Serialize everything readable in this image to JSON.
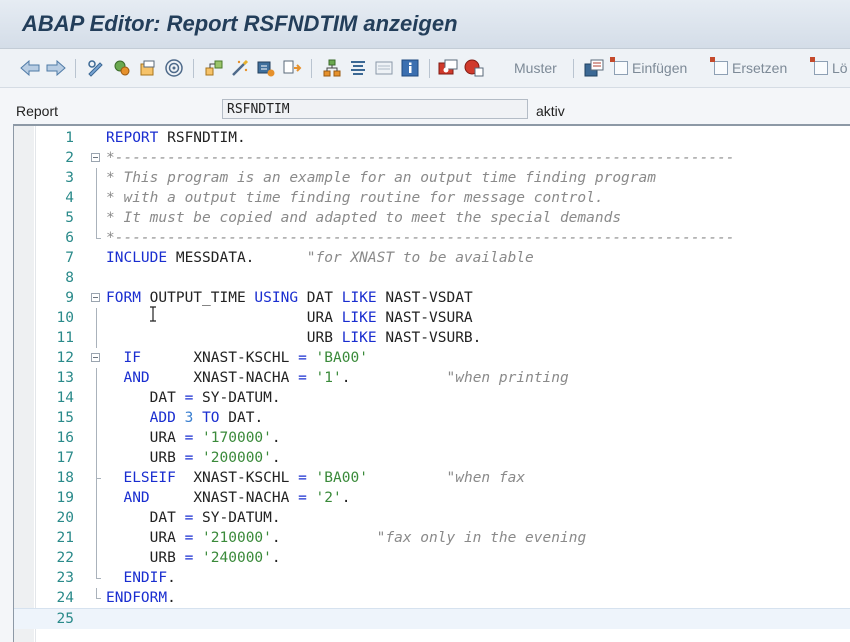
{
  "window": {
    "title": "ABAP Editor: Report RSFNDTIM anzeigen"
  },
  "toolbar": {
    "icons": [
      "back-arrow",
      "forward-arrow",
      "toggle-edit",
      "activate",
      "object-list",
      "where-used",
      "navigation",
      "pretty-printer",
      "enhancement",
      "check",
      "display-object",
      "info",
      "breakpoint-session",
      "breakpoint-external"
    ],
    "muster_label": "Muster",
    "einfuegen_label": "Einfügen",
    "ersetzen_label": "Ersetzen",
    "loeschen_label": "Lö"
  },
  "report": {
    "label": "Report",
    "name": "RSFNDTIM",
    "status": "aktiv"
  },
  "colors": {
    "keyword": "#1a2ed0",
    "comment": "#8a8a8a",
    "string": "#3a8a3a",
    "number": "#3a7fd0",
    "line_number": "#2a8a8a"
  },
  "code": [
    {
      "n": "1",
      "fold": "none",
      "tokens": [
        [
          "kw",
          "REPORT"
        ],
        [
          "id",
          " RSFNDTIM."
        ]
      ]
    },
    {
      "n": "2",
      "fold": "box",
      "tokens": [
        [
          "cm",
          "*-----------------------------------------------------------------------"
        ]
      ]
    },
    {
      "n": "3",
      "fold": "bar",
      "tokens": [
        [
          "cm",
          "* This program is an example for an output time finding program"
        ]
      ]
    },
    {
      "n": "4",
      "fold": "bar",
      "tokens": [
        [
          "cm",
          "* with a output time finding routine for message control."
        ]
      ]
    },
    {
      "n": "5",
      "fold": "bar",
      "tokens": [
        [
          "cm",
          "* It must be copied and adapted to meet the special demands"
        ]
      ]
    },
    {
      "n": "6",
      "fold": "end",
      "tokens": [
        [
          "cm",
          "*-----------------------------------------------------------------------"
        ]
      ]
    },
    {
      "n": "7",
      "fold": "none",
      "tokens": [
        [
          "kw",
          "INCLUDE"
        ],
        [
          "id",
          " MESSDATA.      "
        ],
        [
          "cm",
          "\"for XNAST to be available"
        ]
      ]
    },
    {
      "n": "8",
      "fold": "none",
      "tokens": []
    },
    {
      "n": "9",
      "fold": "box",
      "tokens": [
        [
          "kw",
          "FORM"
        ],
        [
          "id",
          " OUTPUT_TIME "
        ],
        [
          "kw",
          "USING"
        ],
        [
          "id",
          " DAT "
        ],
        [
          "kw",
          "LIKE"
        ],
        [
          "id",
          " NAST-VSDAT"
        ]
      ]
    },
    {
      "n": "10",
      "fold": "bar",
      "tokens": [
        [
          "id",
          "                       URA "
        ],
        [
          "kw",
          "LIKE"
        ],
        [
          "id",
          " NAST-VSURA"
        ]
      ]
    },
    {
      "n": "11",
      "fold": "bar",
      "tokens": [
        [
          "id",
          "                       URB "
        ],
        [
          "kw",
          "LIKE"
        ],
        [
          "id",
          " NAST-VSURB."
        ]
      ]
    },
    {
      "n": "12",
      "fold": "box",
      "tokens": [
        [
          "id",
          "  "
        ],
        [
          "kw",
          "IF"
        ],
        [
          "id",
          "      XNAST-KSCHL "
        ],
        [
          "op",
          "="
        ],
        [
          "id",
          " "
        ],
        [
          "str",
          "'BA00'"
        ]
      ]
    },
    {
      "n": "13",
      "fold": "bar",
      "tokens": [
        [
          "id",
          "  "
        ],
        [
          "kw",
          "AND"
        ],
        [
          "id",
          "     XNAST-NACHA "
        ],
        [
          "op",
          "="
        ],
        [
          "id",
          " "
        ],
        [
          "str",
          "'1'"
        ],
        [
          "id",
          ".           "
        ],
        [
          "cm",
          "\"when printing"
        ]
      ]
    },
    {
      "n": "14",
      "fold": "bar",
      "tokens": [
        [
          "id",
          "     DAT "
        ],
        [
          "op",
          "="
        ],
        [
          "id",
          " SY-DATUM."
        ]
      ]
    },
    {
      "n": "15",
      "fold": "bar",
      "tokens": [
        [
          "id",
          "     "
        ],
        [
          "kw",
          "ADD"
        ],
        [
          "id",
          " "
        ],
        [
          "num",
          "3"
        ],
        [
          "id",
          " "
        ],
        [
          "kw",
          "TO"
        ],
        [
          "id",
          " DAT."
        ]
      ]
    },
    {
      "n": "16",
      "fold": "bar",
      "tokens": [
        [
          "id",
          "     URA "
        ],
        [
          "op",
          "="
        ],
        [
          "id",
          " "
        ],
        [
          "str",
          "'170000'"
        ],
        [
          "id",
          "."
        ]
      ]
    },
    {
      "n": "17",
      "fold": "bar",
      "tokens": [
        [
          "id",
          "     URB "
        ],
        [
          "op",
          "="
        ],
        [
          "id",
          " "
        ],
        [
          "str",
          "'200000'"
        ],
        [
          "id",
          "."
        ]
      ]
    },
    {
      "n": "18",
      "fold": "dot",
      "tokens": [
        [
          "id",
          "  "
        ],
        [
          "kw",
          "ELSEIF"
        ],
        [
          "id",
          "  XNAST-KSCHL "
        ],
        [
          "op",
          "="
        ],
        [
          "id",
          " "
        ],
        [
          "str",
          "'BA00'"
        ],
        [
          "id",
          "         "
        ],
        [
          "cm",
          "\"when fax"
        ]
      ]
    },
    {
      "n": "19",
      "fold": "bar",
      "tokens": [
        [
          "id",
          "  "
        ],
        [
          "kw",
          "AND"
        ],
        [
          "id",
          "     XNAST-NACHA "
        ],
        [
          "op",
          "="
        ],
        [
          "id",
          " "
        ],
        [
          "str",
          "'2'"
        ],
        [
          "id",
          "."
        ]
      ]
    },
    {
      "n": "20",
      "fold": "bar",
      "tokens": [
        [
          "id",
          "     DAT "
        ],
        [
          "op",
          "="
        ],
        [
          "id",
          " SY-DATUM."
        ]
      ]
    },
    {
      "n": "21",
      "fold": "bar",
      "tokens": [
        [
          "id",
          "     URA "
        ],
        [
          "op",
          "="
        ],
        [
          "id",
          " "
        ],
        [
          "str",
          "'210000'"
        ],
        [
          "id",
          ".           "
        ],
        [
          "cm",
          "\"fax only in the evening"
        ]
      ]
    },
    {
      "n": "22",
      "fold": "bar",
      "tokens": [
        [
          "id",
          "     URB "
        ],
        [
          "op",
          "="
        ],
        [
          "id",
          " "
        ],
        [
          "str",
          "'240000'"
        ],
        [
          "id",
          "."
        ]
      ]
    },
    {
      "n": "23",
      "fold": "end",
      "tokens": [
        [
          "id",
          "  "
        ],
        [
          "kw",
          "ENDIF"
        ],
        [
          "id",
          "."
        ]
      ]
    },
    {
      "n": "24",
      "fold": "end",
      "tokens": [
        [
          "kw",
          "ENDFORM"
        ],
        [
          "id",
          "."
        ]
      ]
    },
    {
      "n": "25",
      "fold": "none",
      "tokens": []
    }
  ]
}
